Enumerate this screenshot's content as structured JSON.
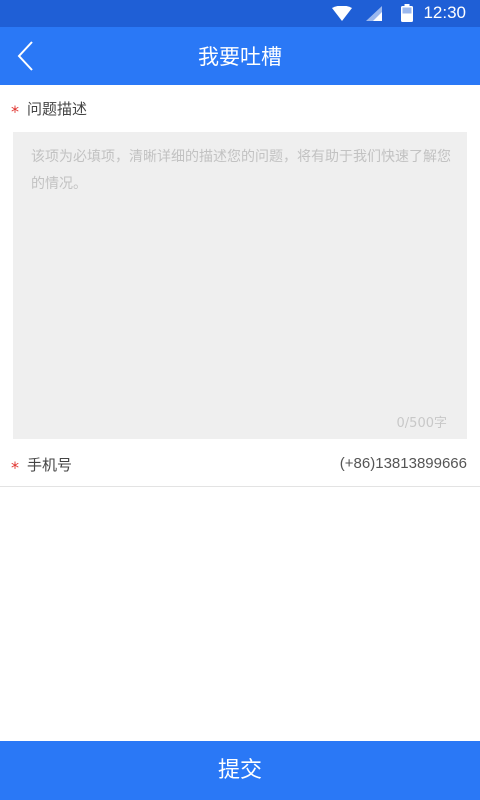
{
  "status_bar": {
    "time": "12:30",
    "icons": [
      "wifi-icon",
      "signal-icon",
      "battery-icon"
    ]
  },
  "app_bar": {
    "title": "我要吐槽",
    "back_icon": "chevron-left-icon"
  },
  "form": {
    "description": {
      "required_mark": "*",
      "label": "问题描述",
      "placeholder": "该项为必填项，清晰详细的描述您的问题，将有助于我们快速了解您的情况。",
      "counter": "0/500字"
    },
    "phone": {
      "required_mark": "*",
      "label": "手机号",
      "value": "(+86)13813899666"
    }
  },
  "submit_label": "提交",
  "colors": {
    "status_bar": "#1f5fd6",
    "primary": "#2a78f6",
    "required": "#e0302b",
    "input_bg": "#efefef"
  }
}
